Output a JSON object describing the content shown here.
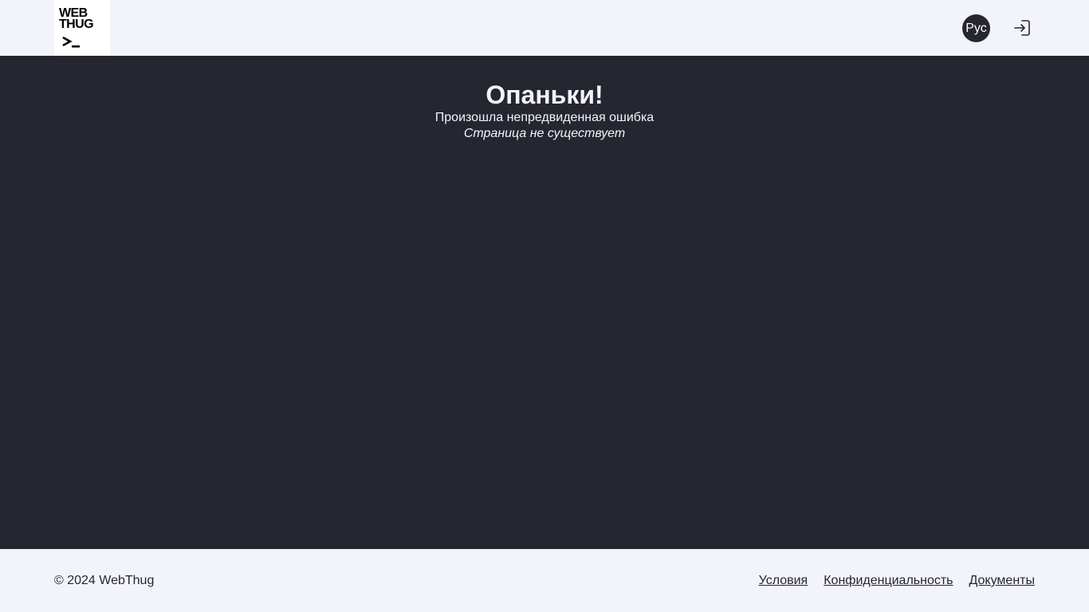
{
  "header": {
    "logo": {
      "line1": "WEB",
      "line2": "THUG",
      "icon": "terminal-prompt-icon"
    },
    "language_button": "Рус",
    "login_icon": "login-icon"
  },
  "error": {
    "title": "Опаньки!",
    "message": "Произошла непредвиденная ошибка",
    "detail": "Страница не существует"
  },
  "footer": {
    "copyright": "© 2024 WebThug",
    "links": [
      "Условия",
      "Конфиденциальность",
      "Документы"
    ]
  },
  "colors": {
    "background_light": "#f3f4f9",
    "background_dark": "#262631",
    "text_light": "#f3f4f9",
    "text_dark": "#262631"
  }
}
